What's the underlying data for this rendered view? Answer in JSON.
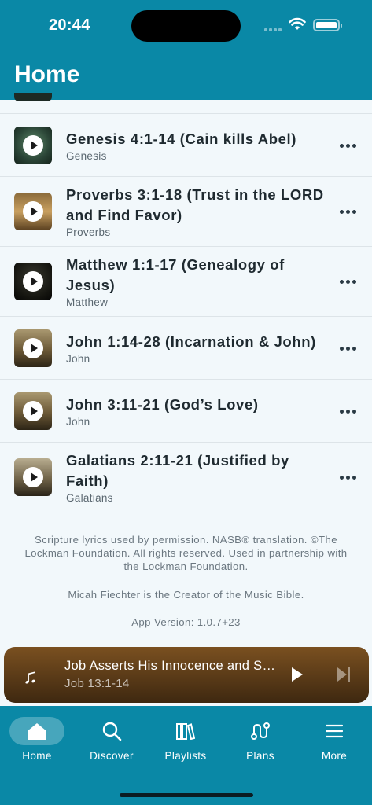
{
  "status_bar": {
    "time": "20:44"
  },
  "header": {
    "title": "Home"
  },
  "songs": [
    {
      "title": "Genesis 4:1-14 (Cain kills Abel)",
      "book": "Genesis"
    },
    {
      "title": "Proverbs 3:1-18 (Trust in the LORD and Find Favor)",
      "book": "Proverbs"
    },
    {
      "title": "Matthew 1:1-17 (Genealogy of Jesus)",
      "book": "Matthew"
    },
    {
      "title": "John 1:14-28 (Incarnation & John)",
      "book": "John"
    },
    {
      "title": "John 3:11-21 (God’s Love)",
      "book": "John"
    },
    {
      "title": "Galatians 2:11-21 (Justified by Faith)",
      "book": "Galatians"
    }
  ],
  "footer": {
    "line1": "Scripture lyrics used by permission. NASB® translation. ©The Lockman Foundation. All rights reserved. Used in partnership with the Lockman Foundation.",
    "line2": "Micah Fiechter is the Creator of the Music Bible.",
    "line3": "App Version: 1.0.7+23"
  },
  "now_playing": {
    "title": "Job Asserts His Innocence and Se...",
    "subtitle": "Job 13:1-14",
    "icon": "music-note-icon"
  },
  "tabs": [
    {
      "label": "Home",
      "icon": "home-icon",
      "active": true
    },
    {
      "label": "Discover",
      "icon": "search-icon",
      "active": false
    },
    {
      "label": "Playlists",
      "icon": "playlists-icon",
      "active": false
    },
    {
      "label": "Plans",
      "icon": "plans-icon",
      "active": false
    },
    {
      "label": "More",
      "icon": "menu-icon",
      "active": false
    }
  ],
  "colors": {
    "brand": "#0a88a6",
    "background": "#f2f8fb",
    "player_top": "#7a5020",
    "player_bottom": "#3e2810"
  }
}
